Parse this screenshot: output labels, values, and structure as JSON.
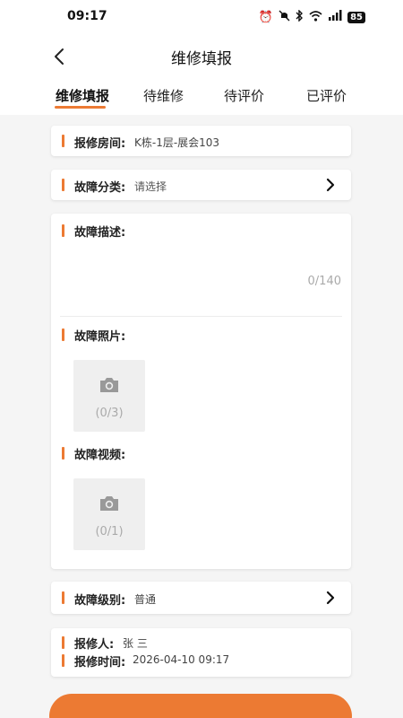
{
  "status_bar": {
    "time": "09:17",
    "battery": "85",
    "icons": [
      "alarm-icon",
      "mute-icon",
      "bluetooth-icon",
      "wifi-icon",
      "signal-icon",
      "battery-icon"
    ]
  },
  "nav": {
    "title": "维修填报",
    "back_icon": "chevron-left-icon"
  },
  "tabs": [
    {
      "label": "维修填报",
      "active": true
    },
    {
      "label": "待维修",
      "active": false
    },
    {
      "label": "待评价",
      "active": false
    },
    {
      "label": "已评价",
      "active": false
    }
  ],
  "form": {
    "room": {
      "label": "报修房间:",
      "value": "K栋-1层-展会103"
    },
    "category": {
      "label": "故障分类:",
      "value": "请选择"
    },
    "description": {
      "label": "故障描述:",
      "counter": "0/140"
    },
    "photos": {
      "label": "故障照片:",
      "count": "(0/3)"
    },
    "videos": {
      "label": "故障视频:",
      "count": "(0/1)"
    },
    "level": {
      "label": "故障级别:",
      "value": "普通"
    },
    "reporter": {
      "label": "报修人:",
      "value": "张 三"
    },
    "report_time": {
      "label": "报修时间:",
      "value": "2026-04-10 09:17"
    }
  },
  "colors": {
    "accent": "#ec7a33",
    "background": "#f5f5f5",
    "card": "#ffffff",
    "placeholder": "#efefef"
  }
}
